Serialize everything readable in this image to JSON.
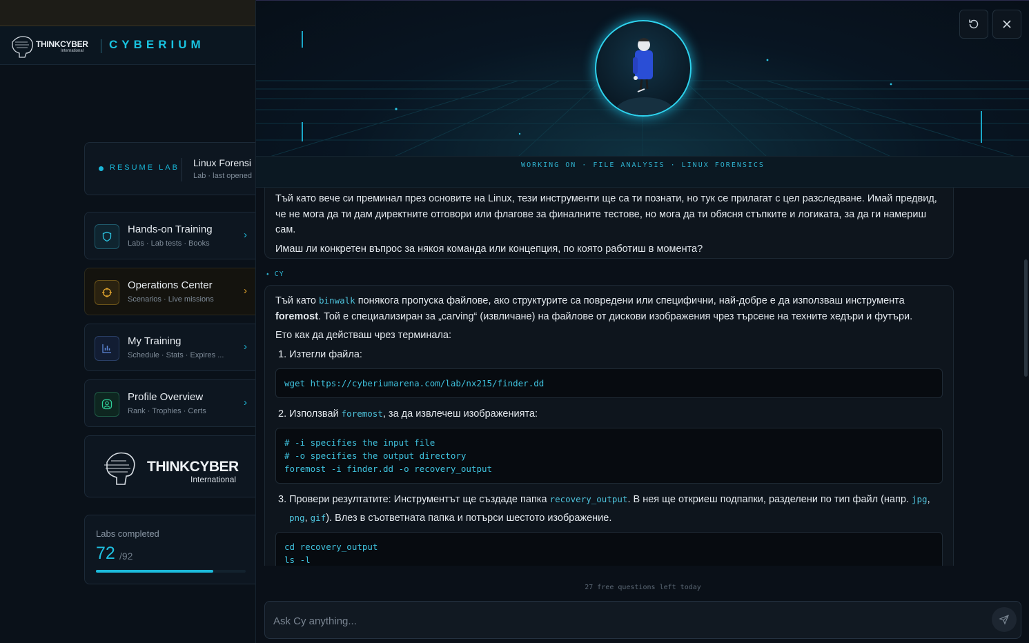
{
  "sidebar": {
    "brand": {
      "company": "THINKCYBER",
      "company_sub": "International",
      "product": "CYBERIUM"
    },
    "resume": {
      "label": "RESUME LAB",
      "title": "Linux Forensi",
      "subtitle": "Lab · last opened"
    },
    "nav": [
      {
        "title": "Hands-on Training",
        "subtitle": "Labs · Lab tests · Books",
        "icon": "shield-icon"
      },
      {
        "title": "Operations Center",
        "subtitle": "Scenarios · Live missions",
        "icon": "crosshair-icon"
      },
      {
        "title": "My Training",
        "subtitle": "Schedule · Stats · Expires ...",
        "icon": "bar-chart-icon"
      },
      {
        "title": "Profile Overview",
        "subtitle": "Rank · Trophies · Certs",
        "icon": "user-circle-icon"
      }
    ],
    "logo_card": {
      "company": "THINKCYBER",
      "company_sub": "International"
    },
    "labs": {
      "label": "Labs completed",
      "completed": "72",
      "total": "/92",
      "progress": 0.7826
    }
  },
  "panel": {
    "working_on": "WORKING ON · FILE ANALYSIS · LINUX FORENSICS",
    "buttons": {
      "reset_icon": "refresh-icon",
      "close_icon": "close-icon"
    },
    "messages": {
      "prev_p1": "Тъй като вече си преминал през основите на Linux, тези инструменти ще са ти познати, но тук се прилагат с цел разследване. Имай предвид, че не мога да ти дам директните отговори или флагове за финалните тестове, но мога да ти обясня стъпките и логиката, за да ги намериш сам.",
      "prev_p2": "Имаш ли конкретен въпрос за някоя команда или концепция, по която работиш в момента?",
      "sender": "CY",
      "intro_a": "Тъй като ",
      "intro_code1": "binwalk",
      "intro_b": " понякога пропуска файлове, ако структурите са повредени или специфични, най-добре е да използваш инструмента ",
      "intro_bold": "foremost",
      "intro_c": ". Той е специализиран за „carving“ (извличане) на файлове от дискови изображения чрез търсене на техните хедъри и футъри.",
      "lead": "Ето как да действаш чрез терминала:",
      "step1": "1. Изтегли файла:",
      "code1": "wget https://cyberiumarena.com/lab/nx215/finder.dd",
      "step2_a": "2. Използвай ",
      "step2_code": "foremost",
      "step2_b": ", за да извлечеш изображенията:",
      "code2": "# -i specifies the input file\n# -o specifies the output directory\nforemost -i finder.dd -o recovery_output",
      "step3_a": "3. Провери резултатите: Инструментът ще създаде папка ",
      "step3_code1": "recovery_output",
      "step3_b": ". В нея ще откриеш подпапки, разделени по тип файл (напр. ",
      "step3_code2": "jpg",
      "step3_c": ",",
      "step3_code3": "png",
      "step3_d": ", ",
      "step3_code4": "gif",
      "step3_e": "). Влез в съответната папка и потърси шестото изображение.",
      "code3": "cd recovery_output\nls -l"
    },
    "quota": "27 free questions left today",
    "input_placeholder": "Ask Cy anything..."
  },
  "colors": {
    "accent": "#1fc0e0",
    "background": "#0a1018",
    "operations_accent": "#d39a2a"
  }
}
